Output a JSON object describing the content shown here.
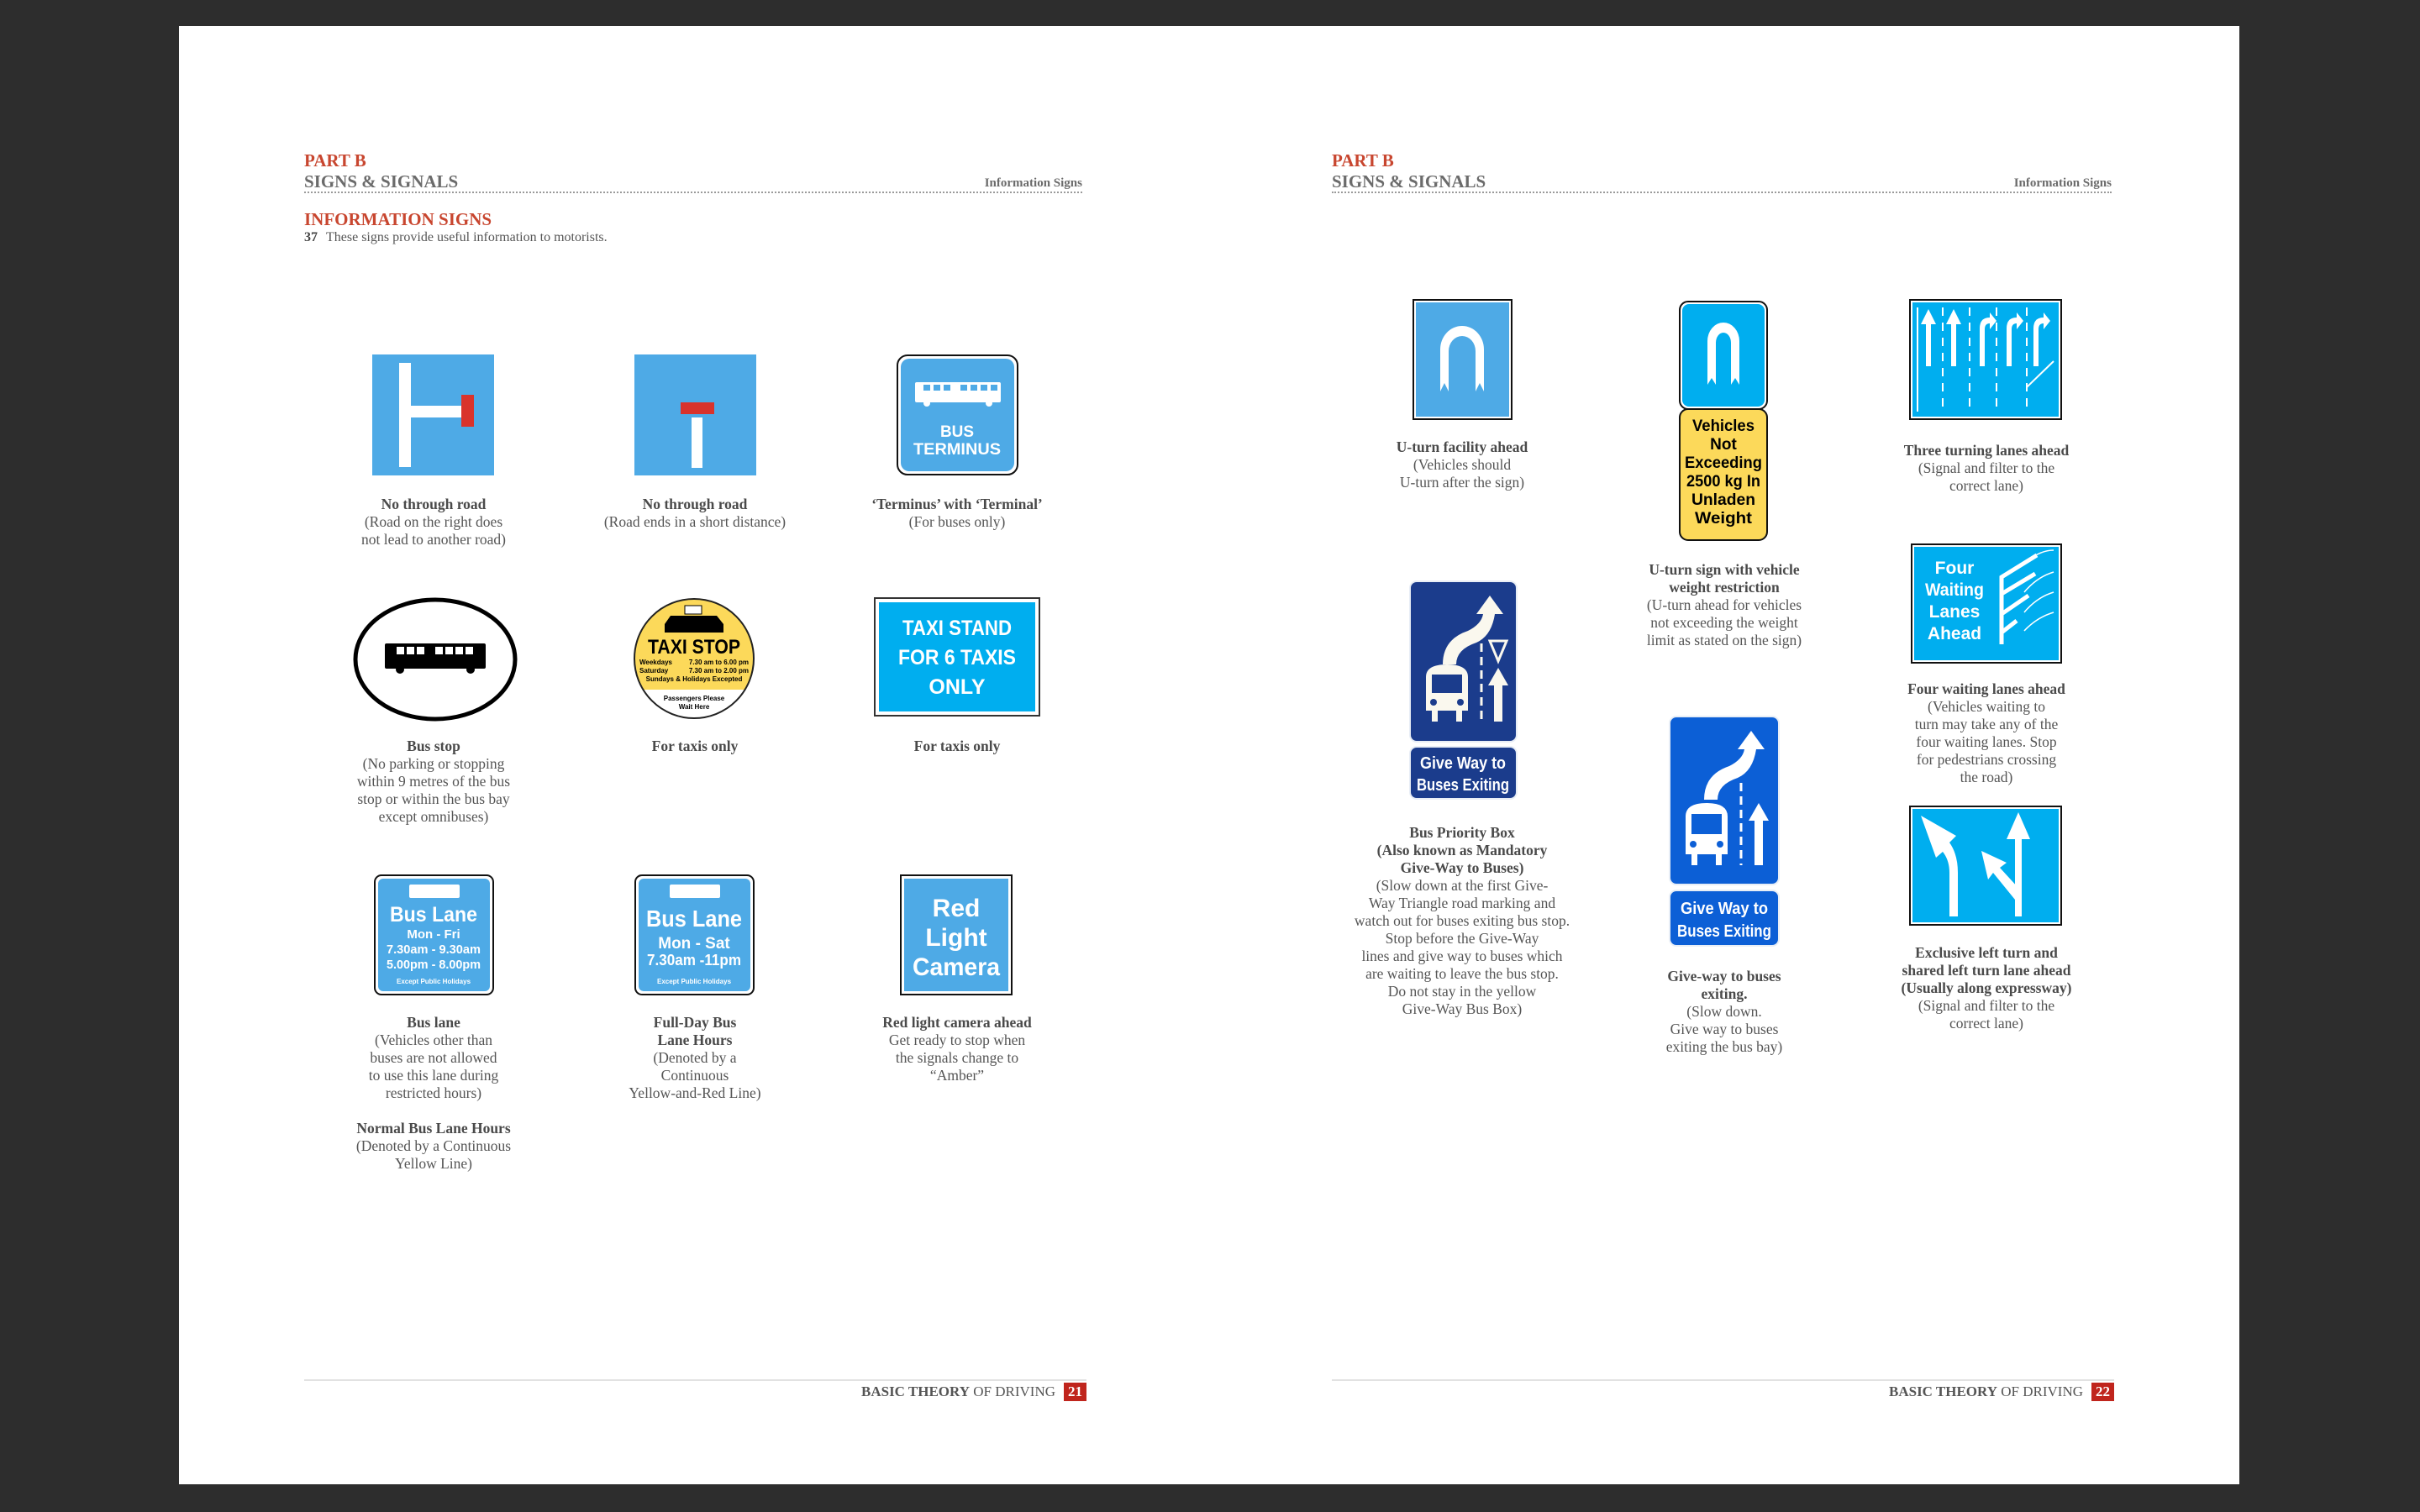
{
  "colors": {
    "light_blue": "#4eaae6",
    "bright_blue": "#00aeef",
    "navy": "#1b3c8c",
    "royal_blue": "#0c5fd6",
    "yellow": "#fcd95a",
    "red": "#d9332c",
    "heading_red": "#c8462f"
  },
  "left_page": {
    "header": {
      "part": "PART B",
      "section": "SIGNS & SIGNALS",
      "right": "Information Signs"
    },
    "title": "INFORMATION SIGNS",
    "intro_num": "37",
    "intro_text": "These signs provide useful information to motorists.",
    "signs": [
      {
        "icon": "no-through-road-right-sign",
        "caption": [
          {
            "t": "No through road",
            "b": true
          },
          {
            "t": "(Road on the right does"
          },
          {
            "t": "not lead to another road)"
          }
        ]
      },
      {
        "icon": "dead-end-sign",
        "caption": [
          {
            "t": "No through road",
            "b": true
          },
          {
            "t": "(Road ends in a short distance)"
          }
        ]
      },
      {
        "icon": "bus-terminus-sign",
        "text": [
          "BUS",
          "TERMINUS"
        ],
        "caption": [
          {
            "t": "‘Terminus’ with ‘Terminal’",
            "b": true
          },
          {
            "t": "(For buses only)"
          }
        ]
      },
      {
        "icon": "bus-stop-sign",
        "caption": [
          {
            "t": "Bus stop",
            "b": true
          },
          {
            "t": "(No parking or stopping"
          },
          {
            "t": "within 9 metres of the bus"
          },
          {
            "t": "stop or within the bus bay"
          },
          {
            "t": "except omnibuses)"
          }
        ]
      },
      {
        "icon": "taxi-stop-sign",
        "text": [
          "TAXI STOP",
          "Weekdays",
          "7.30 am to 6.00 pm",
          "Saturday",
          "7.30 am to 2.00 pm",
          "Sundays & Holidays Excepted",
          "Passengers Please",
          "Wait Here"
        ],
        "caption": [
          {
            "t": "For taxis only",
            "b": true
          }
        ]
      },
      {
        "icon": "taxi-stand-sign",
        "text": [
          "TAXI STAND",
          "FOR 6 TAXIS",
          "ONLY"
        ],
        "caption": [
          {
            "t": "For taxis only",
            "b": true
          }
        ]
      },
      {
        "icon": "bus-lane-sign",
        "text": [
          "Bus Lane",
          "Mon - Fri",
          "7.30am - 9.30am",
          "5.00pm - 8.00pm",
          "Except Public Holidays"
        ],
        "caption": [
          {
            "t": "Bus lane",
            "b": true
          },
          {
            "t": "(Vehicles other than"
          },
          {
            "t": "buses are not allowed"
          },
          {
            "t": "to use this lane during"
          },
          {
            "t": "restricted hours)"
          },
          {
            "t": "",
            "sp": true
          },
          {
            "t": "Normal Bus Lane Hours",
            "b": true
          },
          {
            "t": "(Denoted by a Continuous"
          },
          {
            "t": "Yellow Line)"
          }
        ]
      },
      {
        "icon": "full-day-bus-lane-sign",
        "text": [
          "Bus Lane",
          "Mon - Sat",
          "7.30am -11pm",
          "Except Public Holidays"
        ],
        "caption": [
          {
            "t": "Full-Day Bus",
            "b": true
          },
          {
            "t": "Lane Hours",
            "b": true
          },
          {
            "t": "(Denoted by a"
          },
          {
            "t": "Continuous"
          },
          {
            "t": "Yellow-and-Red Line)"
          }
        ]
      },
      {
        "icon": "red-light-camera-sign",
        "text": [
          "Red",
          "Light",
          "Camera"
        ],
        "caption": [
          {
            "t": "Red light camera ahead",
            "b": true
          },
          {
            "t": "Get ready to stop when"
          },
          {
            "t": "the signals change to"
          },
          {
            "t": "“Amber”"
          }
        ]
      }
    ],
    "footer": {
      "bold": "BASIC THEORY",
      "rest": "OF DRIVING",
      "page": "21"
    }
  },
  "right_page": {
    "header": {
      "part": "PART B",
      "section": "SIGNS & SIGNALS",
      "right": "Information Signs"
    },
    "signs": [
      {
        "icon": "u-turn-sign",
        "caption": [
          {
            "t": "U-turn facility ahead",
            "b": true
          },
          {
            "t": "(Vehicles should"
          },
          {
            "t": "U-turn after the sign)"
          }
        ]
      },
      {
        "icon": "u-turn-weight-sign",
        "text": [
          "Vehicles",
          "Not",
          "Exceeding",
          "2500 kg In",
          "Unladen",
          "Weight"
        ],
        "caption": [
          {
            "t": "U-turn sign with vehicle",
            "b": true
          },
          {
            "t": "weight restriction",
            "b": true
          },
          {
            "t": "(U-turn ahead for vehicles"
          },
          {
            "t": "not exceeding the weight"
          },
          {
            "t": "limit as stated on the sign)"
          }
        ]
      },
      {
        "icon": "three-turning-lanes-sign",
        "caption": [
          {
            "t": "Three turning lanes ahead",
            "b": true
          },
          {
            "t": "(Signal and filter to the"
          },
          {
            "t": "correct lane)"
          }
        ]
      },
      {
        "icon": "four-waiting-lanes-sign",
        "text": [
          "Four",
          "Waiting",
          "Lanes",
          "Ahead"
        ],
        "caption": [
          {
            "t": "Four waiting lanes ahead",
            "b": true
          },
          {
            "t": "(Vehicles waiting to"
          },
          {
            "t": "turn may take any of the"
          },
          {
            "t": "four waiting lanes. Stop"
          },
          {
            "t": "for pedestrians crossing"
          },
          {
            "t": "the road)"
          }
        ]
      },
      {
        "icon": "bus-priority-box-sign",
        "text": [
          "Give Way to",
          "Buses Exiting"
        ],
        "caption": [
          {
            "t": "Bus Priority Box",
            "b": true
          },
          {
            "t": "(Also known as Mandatory",
            "b": true
          },
          {
            "t": "Give-Way to Buses)",
            "b": true
          },
          {
            "t": "(Slow down at the first Give-"
          },
          {
            "t": "Way Triangle road marking and"
          },
          {
            "t": "watch out for buses exiting bus stop."
          },
          {
            "t": "Stop before the Give-Way"
          },
          {
            "t": "lines and give way to buses which"
          },
          {
            "t": "are waiting to leave the bus stop."
          },
          {
            "t": "Do not stay in the yellow"
          },
          {
            "t": "Give-Way Bus Box)"
          }
        ]
      },
      {
        "icon": "give-way-buses-exiting-sign",
        "text": [
          "Give Way to",
          "Buses Exiting"
        ],
        "caption": [
          {
            "t": "Give-way to buses",
            "b": true
          },
          {
            "t": "exiting.",
            "b": true
          },
          {
            "t": "(Slow down."
          },
          {
            "t": "Give way to buses"
          },
          {
            "t": "exiting the bus bay)"
          }
        ]
      },
      {
        "icon": "exclusive-left-turn-sign",
        "caption": [
          {
            "t": "Exclusive left turn and",
            "b": true
          },
          {
            "t": "shared left turn lane ahead",
            "b": true
          },
          {
            "t": "(Usually along expressway)",
            "b": true
          },
          {
            "t": "(Signal and filter to the"
          },
          {
            "t": "correct lane)"
          }
        ]
      }
    ],
    "footer": {
      "bold": "BASIC THEORY",
      "rest": "OF DRIVING",
      "page": "22"
    }
  }
}
